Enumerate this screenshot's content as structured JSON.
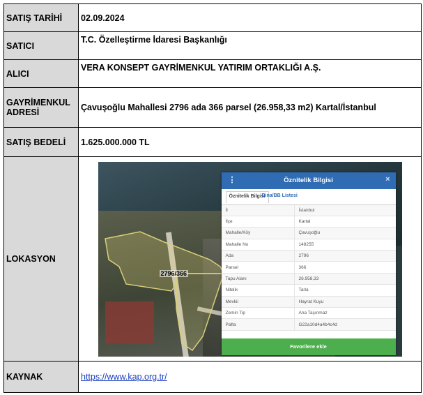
{
  "rows": {
    "sale_date": {
      "label": "SATIŞ TARİHİ",
      "value": "02.09.2024"
    },
    "seller": {
      "label": "SATICI",
      "value": "T.C. Özelleştirme İdaresi Başkanlığı"
    },
    "buyer": {
      "label": "ALICI",
      "value": "VERA KONSEPT GAYRİMENKUL YATIRIM ORTAKLIĞI A.Ş."
    },
    "address": {
      "label": "GAYRİMENKUL ADRESİ",
      "value": "Çavuşoğlu Mahallesi 2796 ada 366 parsel (26.958,33 m2) Kartal/İstanbul"
    },
    "price": {
      "label": "SATIŞ BEDELİ",
      "value": "1.625.000.000 TL"
    },
    "location": {
      "label": "LOKASYON"
    },
    "source": {
      "label": "KAYNAK",
      "value": "https://www.kap.org.tr/"
    }
  },
  "map": {
    "parcel_label": "2796/366",
    "panel": {
      "title": "Öznitelik Bilgisi",
      "kebab_icon": "⋮",
      "close_icon": "×",
      "tabs": [
        "Öznitelik Bilgisi",
        "Bina/BB Listesi"
      ],
      "attributes": [
        {
          "key": "İl",
          "value": "İstanbul"
        },
        {
          "key": "İlçe",
          "value": "Kartal"
        },
        {
          "key": "Mahalle/Köy",
          "value": "Çavuşoğlu"
        },
        {
          "key": "Mahalle No",
          "value": "148255"
        },
        {
          "key": "Ada",
          "value": "2796"
        },
        {
          "key": "Parsel",
          "value": "366"
        },
        {
          "key": "Tapu Alanı",
          "value": "26.958,33"
        },
        {
          "key": "Nitelik",
          "value": "Tarla"
        },
        {
          "key": "Mevkii",
          "value": "Hayrat Kuyu"
        },
        {
          "key": "Zemin Tip",
          "value": "Ana Taşınmaz"
        },
        {
          "key": "Pafta",
          "value": "G22a10d4a4b4c4d"
        }
      ],
      "button": "Favorilere ekle"
    }
  }
}
